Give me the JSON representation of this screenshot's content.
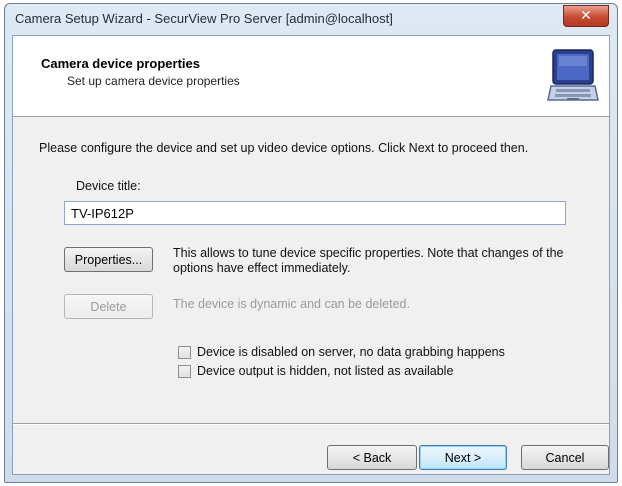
{
  "window": {
    "title": "Camera Setup Wizard - SecurView Pro Server [admin@localhost]",
    "close_glyph": "✕"
  },
  "header": {
    "title": "Camera device properties",
    "subtitle": "Set up camera device properties",
    "icon": "laptop-icon"
  },
  "body": {
    "instructions": "Please configure the device and set up video device options. Click Next to proceed then.",
    "device_title_label": "Device title:",
    "device_title_value": "TV-IP612P",
    "properties_button": "Properties...",
    "properties_description": "This allows to tune device specific properties. Note that changes of the options have effect immediately.",
    "delete_button": "Delete",
    "delete_description": "The device is dynamic and can be deleted.",
    "checkboxes": [
      {
        "label": "Device is disabled on server, no data grabbing happens",
        "checked": false
      },
      {
        "label": "Device output is hidden, not listed as available",
        "checked": false
      }
    ]
  },
  "footer": {
    "back_button": "< Back",
    "next_button": "Next >",
    "cancel_button": "Cancel"
  }
}
